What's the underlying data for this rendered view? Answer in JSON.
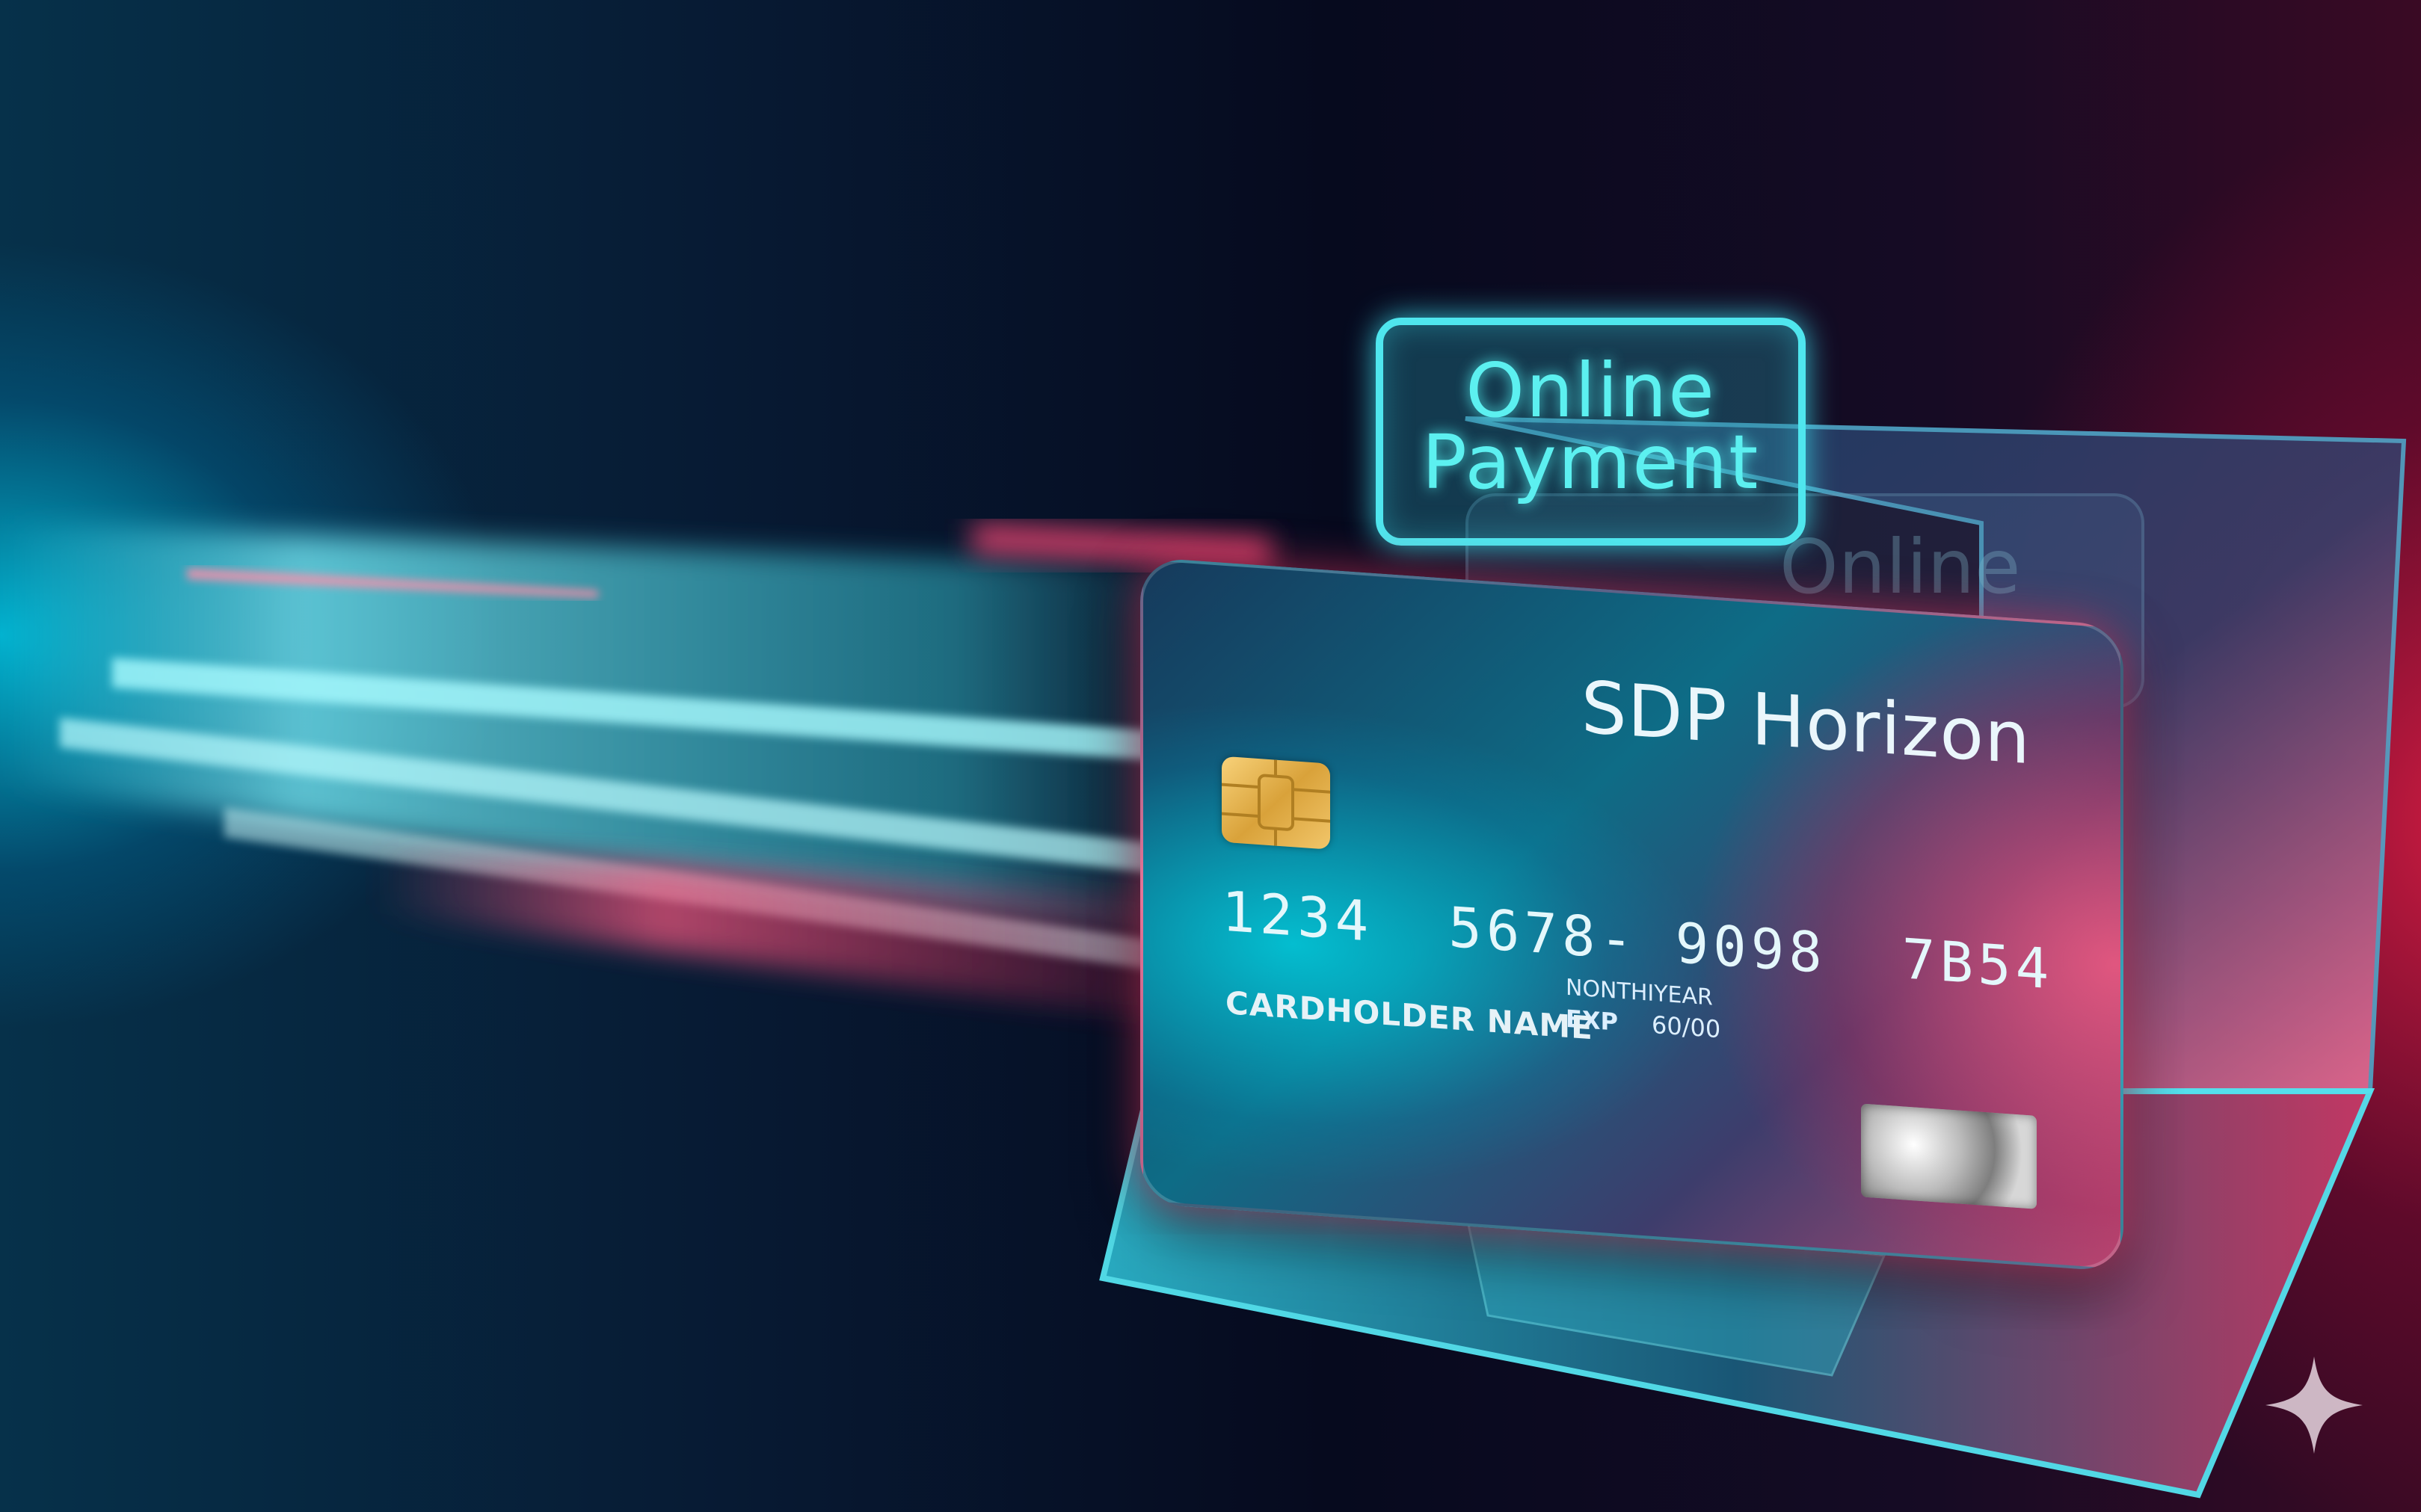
{
  "badge": {
    "line1": "Online",
    "line2": "Payment",
    "ghost_text": "Online",
    "color": "#4fe6ee"
  },
  "card": {
    "brand": "SDP Horizon",
    "number": "1234  5678- 9098  7B54",
    "month_year_label": "NONTHIYEAR",
    "exp_label": "EXP",
    "exp_value": "60/00",
    "cardholder": "CARDHOLDER NAME",
    "chip_icon": "chip-icon",
    "hologram_icon": "hologram-icon"
  },
  "colors": {
    "accent_cyan": "#32e0ee",
    "accent_red": "#e8264f",
    "background": "#060a1e"
  },
  "watermark_icon": "sparkle-icon"
}
